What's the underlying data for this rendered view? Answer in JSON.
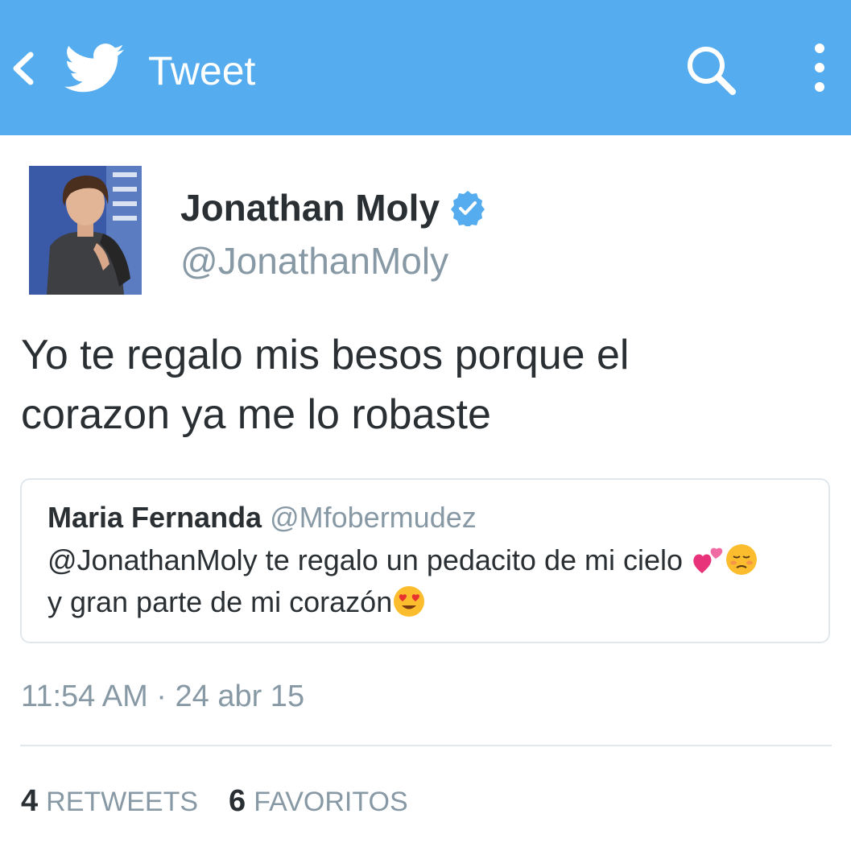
{
  "topbar": {
    "title": "Tweet",
    "background_color": "#55acee",
    "icons": [
      "back-icon",
      "twitter-bird-icon",
      "search-icon",
      "overflow-menu-icon"
    ]
  },
  "author": {
    "name": "Jonathan Moly",
    "handle": "@JonathanMoly",
    "verified": true,
    "verified_color": "#55acee"
  },
  "tweet": {
    "text": "Yo te regalo mis besos porque el\ncorazon ya me lo robaste",
    "timestamp": "11:54 AM · 24 abr 15"
  },
  "quoted_tweet": {
    "name": "Maria Fernanda",
    "handle": "@Mfobermudez",
    "text_part1": "@JonathanMoly te regalo un pedacito de mi cielo ",
    "text_part2": "y gran parte de mi corazón",
    "emojis": [
      "two-hearts-emoji",
      "pensive-face-emoji",
      "heart-eyes-emoji"
    ]
  },
  "stats": {
    "retweets_count": "4",
    "retweets_label": "Retweets",
    "favorites_count": "6",
    "favorites_label": "Favoritos"
  }
}
